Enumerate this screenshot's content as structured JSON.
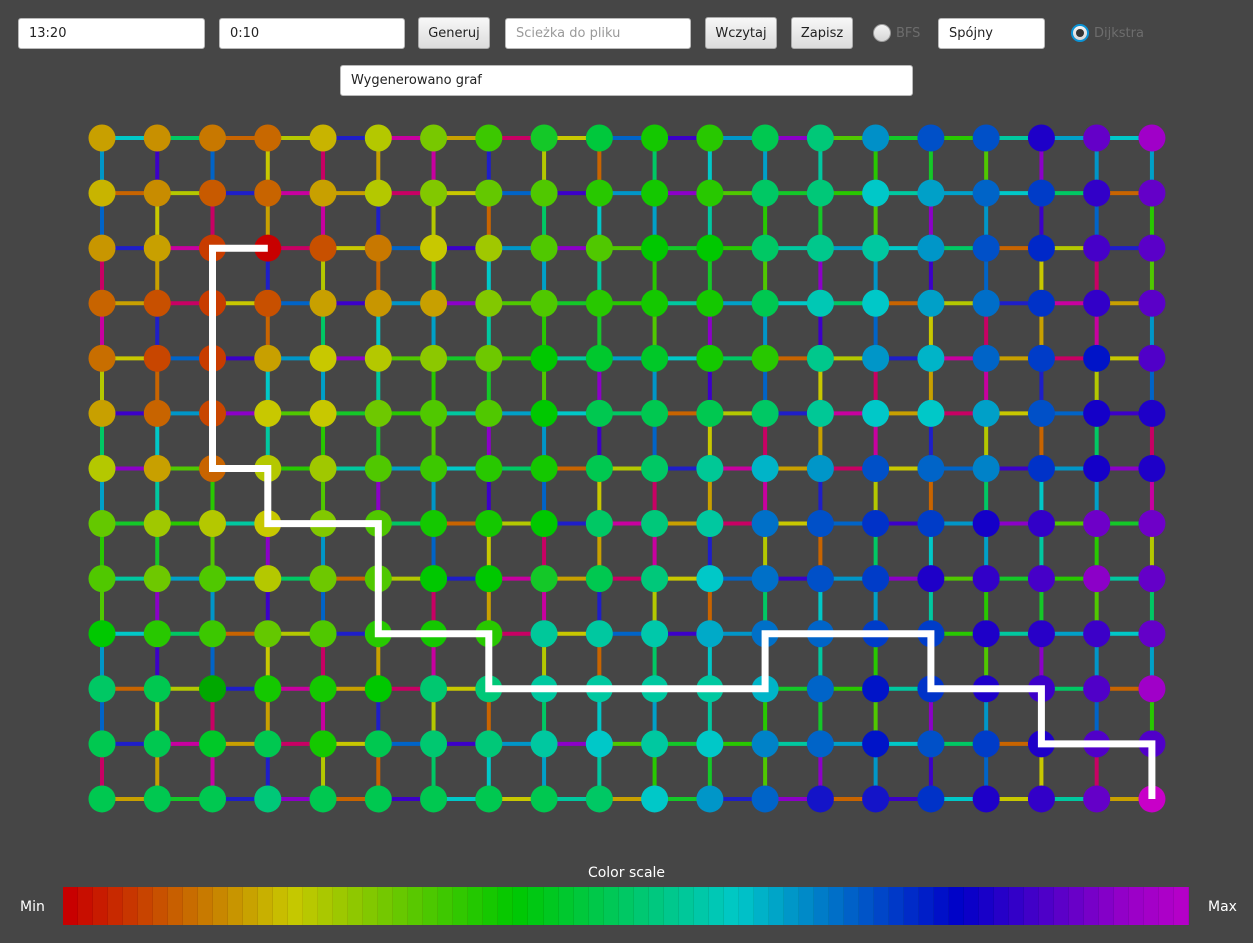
{
  "toolbar": {
    "size_value": "13:20",
    "weight_range_value": "0:10",
    "generate_label": "Generuj",
    "path_placeholder": "Ścieżka do pliku",
    "load_label": "Wczytaj",
    "save_label": "Zapisz",
    "bfs_label": "BFS",
    "bfs_checked": false,
    "connectivity_value": "Spójny",
    "dijkstra_label": "Dijkstra",
    "dijkstra_checked": true
  },
  "status": {
    "message": "Wygenerowano graf"
  },
  "graph": {
    "rows": 13,
    "cols": 20,
    "node_colors_hex": [
      [
        "#c8a000",
        "#c89000",
        "#c87800",
        "#c86800",
        "#c8b400",
        "#b4c800",
        "#78c800",
        "#3cc800",
        "#14c828",
        "#00c83c",
        "#14c800",
        "#28c800",
        "#00c850",
        "#00c878",
        "#0090c8",
        "#0050c8",
        "#0050c8",
        "#1e00c8",
        "#6400c8",
        "#a000c8"
      ],
      [
        "#c8b400",
        "#c88c00",
        "#c85a00",
        "#c86400",
        "#c8a000",
        "#b4c800",
        "#82c800",
        "#64c800",
        "#50c800",
        "#28c800",
        "#14c800",
        "#28c800",
        "#00c864",
        "#00c878",
        "#00c8c8",
        "#00a0c8",
        "#0064c8",
        "#003cc8",
        "#3200c8",
        "#6400c8"
      ],
      [
        "#c89600",
        "#c8a000",
        "#c83c00",
        "#c80000",
        "#c85000",
        "#c87800",
        "#c8c800",
        "#a0c800",
        "#50c800",
        "#50c800",
        "#00c800",
        "#00c800",
        "#00c864",
        "#00c88c",
        "#00c8a0",
        "#0096c8",
        "#0050c8",
        "#0028c8",
        "#4600c8",
        "#5a00c8"
      ],
      [
        "#c86400",
        "#c85000",
        "#c83c00",
        "#c85000",
        "#c8a000",
        "#c89600",
        "#c8a000",
        "#82c800",
        "#50c800",
        "#28c800",
        "#14c800",
        "#14c800",
        "#00c850",
        "#00c8b4",
        "#00c8c8",
        "#00a0c8",
        "#006ec8",
        "#0032c8",
        "#3200c8",
        "#5a00c8"
      ],
      [
        "#c86e00",
        "#c84600",
        "#c83c00",
        "#c8a000",
        "#c8c800",
        "#b4c800",
        "#8cc800",
        "#6ec800",
        "#00c800",
        "#00c82d",
        "#00c828",
        "#14c800",
        "#28c800",
        "#00c88c",
        "#0096c8",
        "#00b4c8",
        "#0064c8",
        "#003cc8",
        "#0014c8",
        "#5000c8"
      ],
      [
        "#c8a000",
        "#c86400",
        "#c84600",
        "#c8c800",
        "#c8c800",
        "#6ec800",
        "#50c800",
        "#50c800",
        "#00c800",
        "#00c850",
        "#00c850",
        "#00c850",
        "#00c864",
        "#00c896",
        "#00c8c8",
        "#00c8c8",
        "#00a0c8",
        "#0050c8",
        "#1400c8",
        "#1e00c8"
      ],
      [
        "#b4c800",
        "#c8a000",
        "#c86400",
        "#b4c800",
        "#a0c800",
        "#50c800",
        "#3cc800",
        "#28c800",
        "#14c800",
        "#00c850",
        "#00c864",
        "#00c896",
        "#00b4c8",
        "#0096c8",
        "#0050c8",
        "#0064c8",
        "#0082c8",
        "#0032c8",
        "#1400c8",
        "#1e00c8"
      ],
      [
        "#64c800",
        "#a0c800",
        "#b4c800",
        "#c8c800",
        "#82c800",
        "#50c800",
        "#14c800",
        "#14c800",
        "#00c800",
        "#00c864",
        "#00c87a",
        "#00c8a0",
        "#0070c8",
        "#0050c8",
        "#0032c8",
        "#003cc8",
        "#1400c8",
        "#3200c8",
        "#6e00c8",
        "#6e00c8"
      ],
      [
        "#50c800",
        "#6ec800",
        "#50c800",
        "#b4c800",
        "#6ec800",
        "#50c800",
        "#00c800",
        "#00c800",
        "#14c828",
        "#00c850",
        "#00c87a",
        "#00c8c8",
        "#0070c8",
        "#0050c8",
        "#003cc8",
        "#1e00c8",
        "#3200c8",
        "#4600c8",
        "#8c00c8",
        "#6400c8"
      ],
      [
        "#00c800",
        "#28c800",
        "#3cc800",
        "#64c800",
        "#50c800",
        "#28c800",
        "#14c800",
        "#28c800",
        "#00c89a",
        "#00c8a0",
        "#00c8aa",
        "#00aac8",
        "#0070c8",
        "#0064c8",
        "#003cc8",
        "#003cc8",
        "#1e00c8",
        "#2800c8",
        "#3c00c8",
        "#6400c8"
      ],
      [
        "#00c864",
        "#00c850",
        "#00a800",
        "#14c800",
        "#14c800",
        "#00c800",
        "#00c870",
        "#00c878",
        "#00c8a0",
        "#00c8a0",
        "#00c8a0",
        "#00c8a0",
        "#00b4c8",
        "#0064c8",
        "#0014c8",
        "#0032c8",
        "#1e00c8",
        "#3c00c8",
        "#5000c8",
        "#a000c8"
      ],
      [
        "#00c850",
        "#00c850",
        "#00c828",
        "#00c850",
        "#14c800",
        "#00c850",
        "#00c870",
        "#00c878",
        "#00c8a0",
        "#00c8c8",
        "#00c8a0",
        "#00c8c8",
        "#0082c8",
        "#0064c8",
        "#0014c8",
        "#0050c8",
        "#003cc8",
        "#1e00c8",
        "#5000c8",
        "#5000c8"
      ],
      [
        "#00c850",
        "#00c850",
        "#00c850",
        "#00c878",
        "#00c850",
        "#00c850",
        "#00c850",
        "#00c850",
        "#00c850",
        "#00c864",
        "#00c8c8",
        "#0096c8",
        "#0064c8",
        "#1414c8",
        "#1414c8",
        "#0032c8",
        "#1e00c8",
        "#3200c8",
        "#6400c8",
        "#c800c8"
      ]
    ],
    "edge_palette_hex": [
      "#00c8c8",
      "#0096c8",
      "#1e1ec8",
      "#28c800",
      "#c8c800",
      "#00c864",
      "#8c00c8",
      "#c800a0",
      "#00c8a0",
      "#0064c8",
      "#c86400",
      "#50c800",
      "#c8a000",
      "#00a0c8",
      "#3c00c8",
      "#b4c800",
      "#14c828",
      "#c80064"
    ],
    "path_cells": [
      [
        2,
        3
      ],
      [
        2,
        2
      ],
      [
        6,
        2
      ],
      [
        6,
        3
      ],
      [
        7,
        3
      ],
      [
        7,
        5
      ],
      [
        9,
        5
      ],
      [
        9,
        7
      ],
      [
        10,
        7
      ],
      [
        10,
        12
      ],
      [
        9,
        12
      ],
      [
        9,
        15
      ],
      [
        10,
        15
      ],
      [
        10,
        17
      ],
      [
        11,
        17
      ],
      [
        11,
        19
      ],
      [
        12,
        19
      ]
    ],
    "path_color_hex": "#ffffff"
  },
  "scale": {
    "title": "Color scale",
    "min_label": "Min",
    "max_label": "Max",
    "gradient_hex": [
      "#c80000",
      "#c83200",
      "#c86400",
      "#c89600",
      "#c8c800",
      "#96c800",
      "#64c800",
      "#32c800",
      "#00c800",
      "#00c832",
      "#00c864",
      "#00c896",
      "#00c8c8",
      "#0096c8",
      "#0064c8",
      "#0032c8",
      "#0000c8",
      "#3200c8",
      "#6400c8",
      "#9600c8",
      "#b400c8"
    ]
  }
}
